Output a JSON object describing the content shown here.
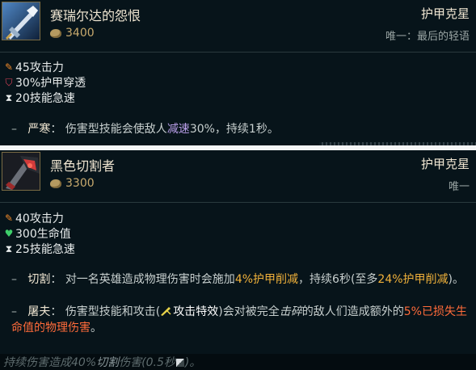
{
  "items": [
    {
      "name": "赛瑞尔达的怨恨",
      "price": "3400",
      "class": "护甲克星",
      "unique": "唯一：最后的轻语",
      "stats": [
        {
          "icon": "attack-damage-icon",
          "text": "45攻击力"
        },
        {
          "icon": "armor-penetration-icon",
          "text": "30%护甲穿透"
        },
        {
          "icon": "ability-haste-icon",
          "text": "20技能急速"
        }
      ],
      "passives": [
        {
          "dash": "–",
          "name": "严寒",
          "sep": "：",
          "p1": "伤害型技能会使敌人",
          "slow": "减速",
          "p2": "30%，持续1秒。"
        }
      ]
    },
    {
      "name": "黑色切割者",
      "price": "3300",
      "class": "护甲克星",
      "unique": "唯一",
      "stats": [
        {
          "icon": "attack-damage-icon",
          "text": "40攻击力"
        },
        {
          "icon": "health-icon",
          "text": "300生命值"
        },
        {
          "icon": "ability-haste-icon",
          "text": "25技能急速"
        }
      ],
      "passives": [
        {
          "dash": "–",
          "name": "切割",
          "sep": "：",
          "p1": "对一名英雄造成物理伤害时会施加",
          "g1": "4%护甲削减",
          "p2": "，持续6秒(至多",
          "g2": "24%护甲削减",
          "p3": ")。"
        },
        {
          "dash": "–",
          "name": "屠夫",
          "sep": "：",
          "p1": "伤害型技能和攻击(",
          "p2": "攻击特效",
          "p3": ")会对被完全",
          "p4": "击碎",
          "p5": "的敌人们造成额外的",
          "r1": "5%已损失生命值的物理伤害",
          "p6": "。"
        }
      ]
    }
  ],
  "footer": {
    "p1": "持续伤害造成40%",
    "strong": "切割",
    "p2": "伤害(0.5秒",
    "p3": ")。"
  }
}
